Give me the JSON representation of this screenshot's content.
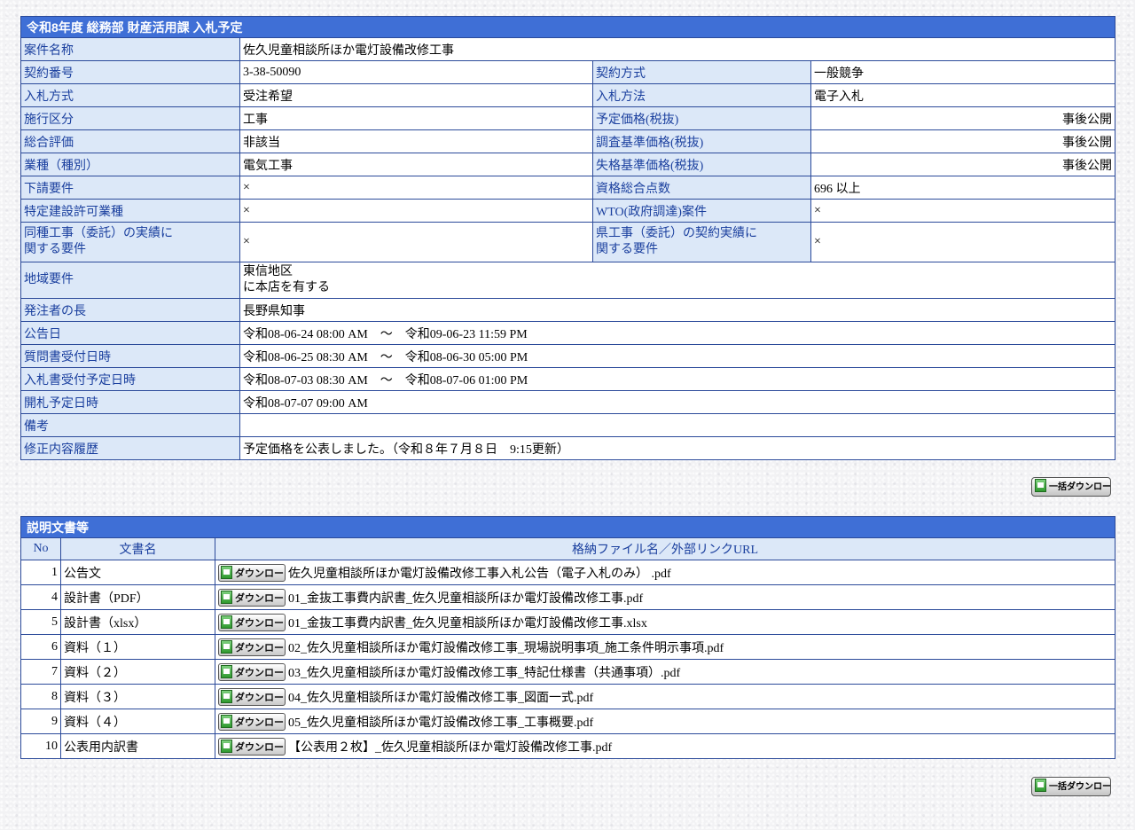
{
  "main": {
    "title": "令和8年度 総務部 財産活用課 入札予定",
    "case_name": {
      "label": "案件名称",
      "value": "佐久児童相談所ほか電灯設備改修工事"
    },
    "rows": [
      {
        "l1": "契約番号",
        "v1": "3-38-50090",
        "l2": "契約方式",
        "v2": "一般競争"
      },
      {
        "l1": "入札方式",
        "v1": "受注希望",
        "l2": "入札方法",
        "v2": "電子入札"
      },
      {
        "l1": "施行区分",
        "v1": "工事",
        "l2": "予定価格(税抜)",
        "v2": "事後公開"
      },
      {
        "l1": "総合評価",
        "v1": "非該当",
        "l2": "調査基準価格(税抜)",
        "v2": "事後公開"
      },
      {
        "l1": "業種（種別）",
        "v1": "電気工事",
        "l2": "失格基準価格(税抜)",
        "v2": "事後公開"
      },
      {
        "l1": "下請要件",
        "v1": "×",
        "l2": "資格総合点数",
        "v2": "696 以上"
      },
      {
        "l1": "特定建設許可業種",
        "v1": "×",
        "l2": "WTO(政府調達)案件",
        "v2": "×"
      }
    ],
    "same_kind": {
      "l1a": "同種工事（委託）の実績に",
      "l1b": "関する要件",
      "v1": "×",
      "l2a": "県工事（委託）の契約実績に",
      "l2b": "関する要件",
      "v2": "×"
    },
    "region": {
      "label": "地域要件",
      "line1": "東信地区",
      "line2": "に本店を有する"
    },
    "single_rows": [
      {
        "label": "発注者の長",
        "value": "長野県知事"
      },
      {
        "label": "公告日",
        "value": "令和08-06-24 08:00 AM　～　令和09-06-23 11:59 PM"
      },
      {
        "label": "質問書受付日時",
        "value": "令和08-06-25 08:30 AM　～　令和08-06-30 05:00 PM"
      },
      {
        "label": "入札書受付予定日時",
        "value": "令和08-07-03 08:30 AM　～　令和08-07-06 01:00 PM"
      },
      {
        "label": "開札予定日時",
        "value": "令和08-07-07 09:00 AM"
      },
      {
        "label": "備考",
        "value": ""
      },
      {
        "label": "修正内容履歴",
        "value": "予定価格を公表しました。（令和８年７月８日　9:15更新）"
      }
    ]
  },
  "bulk_download_label": "一括ダウンロード",
  "docs": {
    "title": "説明文書等",
    "headers": {
      "no": "No",
      "name": "文書名",
      "file": "格納ファイル名／外部リンクURL"
    },
    "download_label": "ダウンロード",
    "items": [
      {
        "no": "1",
        "name": "公告文",
        "file": "佐久児童相談所ほか電灯設備改修工事入札公告（電子入札のみ） .pdf"
      },
      {
        "no": "4",
        "name": "設計書（PDF）",
        "file": "01_金抜工事費内訳書_佐久児童相談所ほか電灯設備改修工事.pdf"
      },
      {
        "no": "5",
        "name": "設計書（xlsx）",
        "file": "01_金抜工事費内訳書_佐久児童相談所ほか電灯設備改修工事.xlsx"
      },
      {
        "no": "6",
        "name": "資料（１）",
        "file": "02_佐久児童相談所ほか電灯設備改修工事_現場説明事項_施工条件明示事項.pdf"
      },
      {
        "no": "7",
        "name": "資料（２）",
        "file": "03_佐久児童相談所ほか電灯設備改修工事_特記仕様書（共通事項）.pdf"
      },
      {
        "no": "8",
        "name": "資料（３）",
        "file": "04_佐久児童相談所ほか電灯設備改修工事_図面一式.pdf"
      },
      {
        "no": "9",
        "name": "資料（４）",
        "file": "05_佐久児童相談所ほか電灯設備改修工事_工事概要.pdf"
      },
      {
        "no": "10",
        "name": "公表用内訳書",
        "file": "【公表用２枚】_佐久児童相談所ほか電灯設備改修工事.pdf"
      }
    ]
  }
}
